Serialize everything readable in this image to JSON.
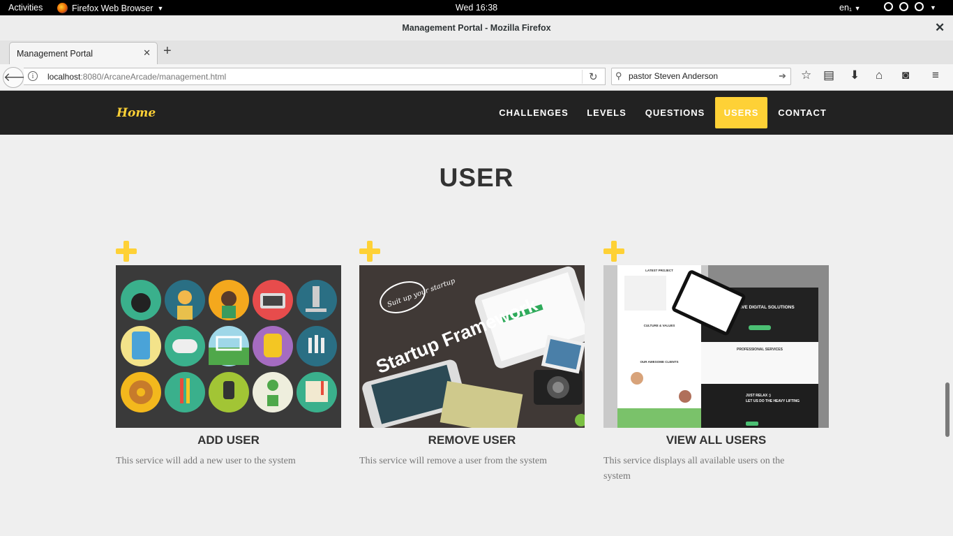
{
  "system": {
    "activities": "Activities",
    "app_name": "Firefox Web Browser",
    "clock": "Wed 16:38",
    "language": "en₁"
  },
  "window": {
    "title": "Management Portal - Mozilla Firefox"
  },
  "browser": {
    "tab_label": "Management Portal",
    "url_host": "localhost",
    "url_rest": ":8080/ArcaneArcade/management.html",
    "search_value": "pastor Steven Anderson"
  },
  "site": {
    "brand": "Home",
    "nav": [
      "CHALLENGES",
      "LEVELS",
      "QUESTIONS",
      "USERS",
      "CONTACT"
    ],
    "active_nav": "USERS",
    "accent_color": "#fed136",
    "header_bg": "#222222"
  },
  "page": {
    "heading": "USER"
  },
  "cards": [
    {
      "title": "ADD USER",
      "desc": "This service will add a new user to the system"
    },
    {
      "title": "REMOVE USER",
      "desc": "This service will remove a user from the system"
    },
    {
      "title": "VIEW ALL USERS",
      "desc": "This service displays all available users on the system"
    }
  ],
  "card_images": {
    "remove_user": {
      "badge": "Suit up your startup",
      "headline": "Startup Framework"
    },
    "view_all": {
      "hero": "CREATIVE DIGITAL SOLUTIONS",
      "section1": "LATEST PROJECT",
      "section2": "PROFESSIONAL SERVICES",
      "section3": "CULTURE & VALUES",
      "section4": "OUR AWESOME CLIENTS",
      "footer1": "JUST RELAX :)",
      "footer2": "LET US DO THE HEAVY LIFTING"
    }
  }
}
